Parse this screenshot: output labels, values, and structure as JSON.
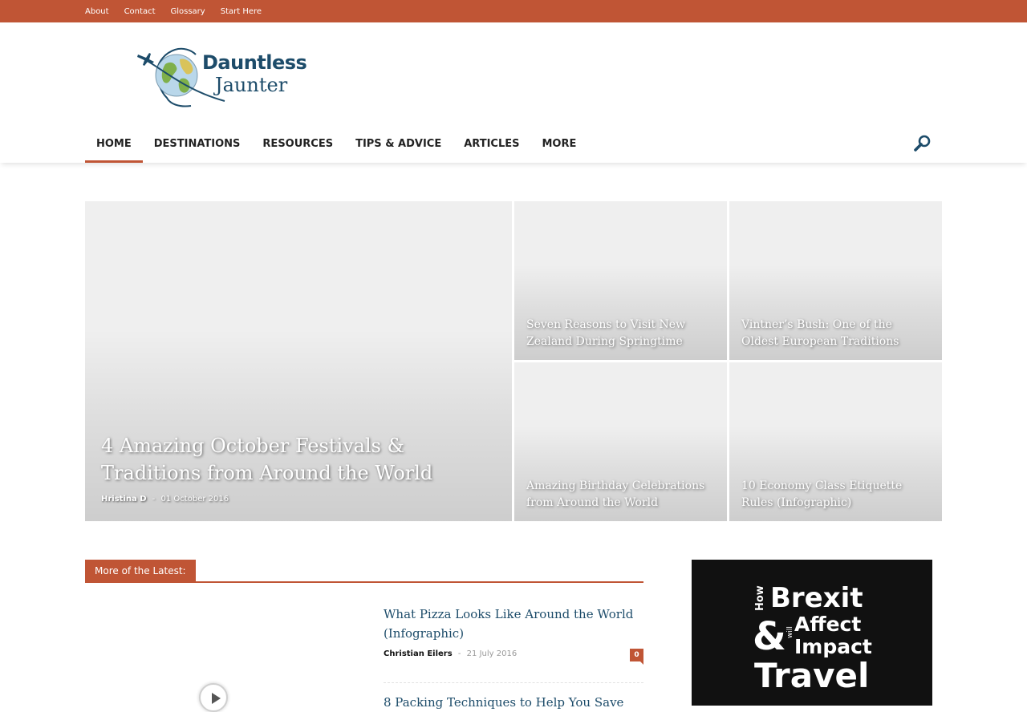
{
  "topbar": {
    "links": [
      "About",
      "Contact",
      "Glossary",
      "Start Here"
    ]
  },
  "logo": {
    "line1": "Dauntless",
    "line2": "Jaunter"
  },
  "nav": {
    "items": [
      "HOME",
      "DESTINATIONS",
      "RESOURCES",
      "TIPS & ADVICE",
      "ARTICLES",
      "MORE"
    ],
    "active": "HOME"
  },
  "featured": {
    "main": {
      "title": "4 Amazing October Festivals & Traditions from Around the World",
      "author": "Hristina D",
      "separator": "-",
      "date": "01 October 2016"
    },
    "tiles": [
      {
        "title": "Seven Reasons to Visit New Zealand During Springtime"
      },
      {
        "title": "Vintner’s Bush: One of the Oldest European Traditions"
      },
      {
        "title": "Amazing Birthday Celebrations from Around the World"
      },
      {
        "title": "10 Economy Class Etiquette Rules (Infographic)"
      }
    ]
  },
  "latest": {
    "heading": "More of the Latest:",
    "posts": [
      {
        "title": "What Pizza Looks Like Around the World (Infographic)",
        "author": "Christian Eilers",
        "separator": "-",
        "date": "21 July 2016",
        "comments": "0"
      },
      {
        "title": "8 Packing Techniques to Help You Save"
      }
    ]
  },
  "ad": {
    "how": "How",
    "brexit": "Brexit",
    "amp": "&",
    "will": "will",
    "affect": "Affect",
    "impact": "Impact",
    "travel": "Travel"
  },
  "colors": {
    "accent": "#c05535",
    "brand": "#1d4c6a"
  }
}
